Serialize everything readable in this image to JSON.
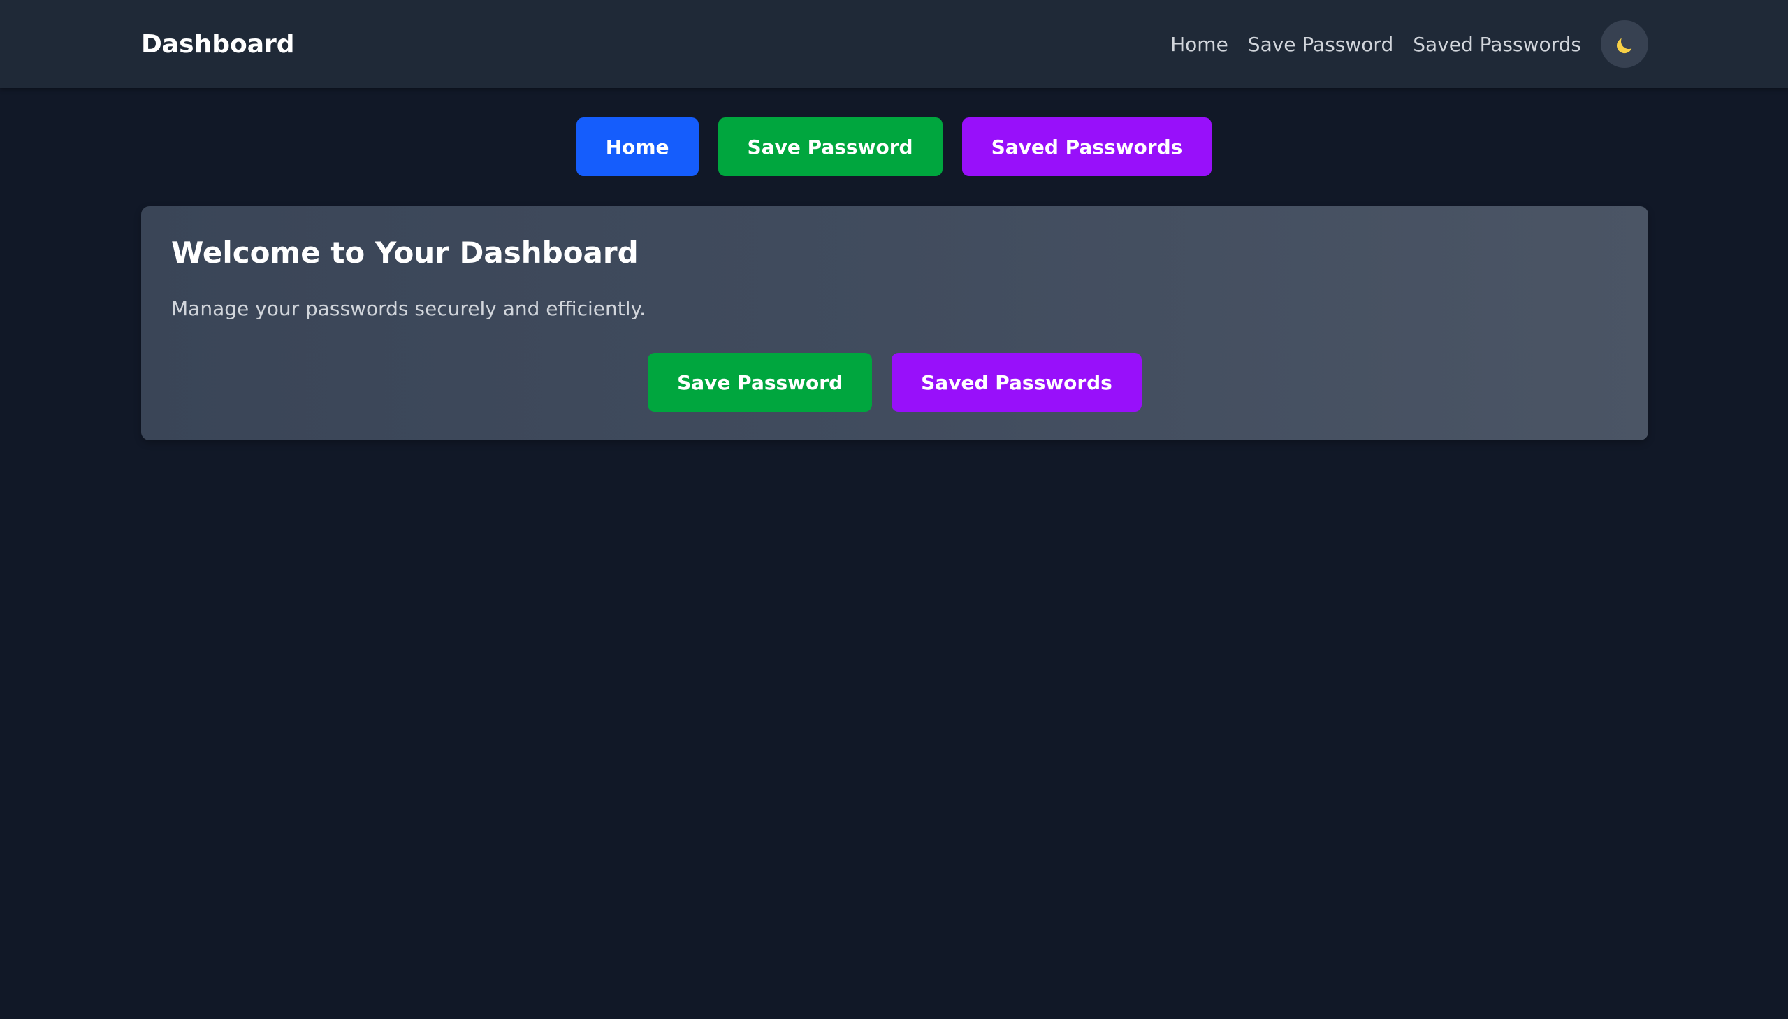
{
  "navbar": {
    "brand": "Dashboard",
    "links": [
      "Home",
      "Save Password",
      "Saved Passwords"
    ],
    "theme_toggle_icon": "moon-icon"
  },
  "top_buttons": {
    "home": "Home",
    "save_password": "Save Password",
    "saved_passwords": "Saved Passwords"
  },
  "card": {
    "title": "Welcome to Your Dashboard",
    "subtitle": "Manage your passwords securely and efficiently.",
    "save_password": "Save Password",
    "saved_passwords": "Saved Passwords"
  },
  "colors": {
    "background": "#111827",
    "navbar": "#1f2937",
    "blue": "#155dfc",
    "green": "#00a63e",
    "purple": "#9810fa",
    "moon": "#f7d046"
  }
}
